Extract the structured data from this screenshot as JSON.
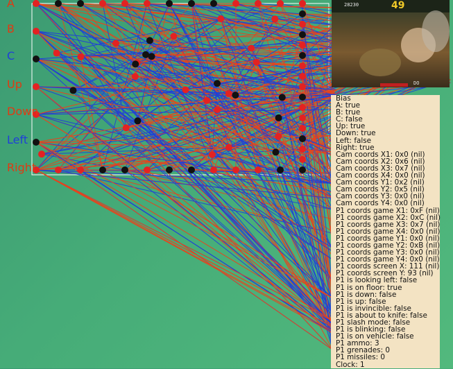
{
  "buttons": [
    {
      "label": "A",
      "color": "#e03a12"
    },
    {
      "label": "B",
      "color": "#e03a12"
    },
    {
      "label": "C",
      "color": "#1f3fd8"
    },
    {
      "label": "Up",
      "color": "#e03a12"
    },
    {
      "label": "Down",
      "color": "#e03a12"
    },
    {
      "label": "Left",
      "color": "#1f3fd8"
    },
    {
      "label": "Right",
      "color": "#e03a12"
    }
  ],
  "game_hud": {
    "score": "28230",
    "time": "49",
    "bottom_text": "DO"
  },
  "status_lines": [
    "Bias",
    "A: true",
    "B: true",
    "C: false",
    "Up: true",
    "Down: true",
    "Left: false",
    "Right: true",
    "Cam coords X1: 0x0 (nil)",
    "Cam coords X2: 0x6 (nil)",
    "Cam coords X3: 0x7 (nil)",
    "Cam coords X4: 0x0 (nil)",
    "Cam coords Y1: 0x2 (nil)",
    "Cam coords Y2: 0x5 (nil)",
    "Cam coords Y3: 0x0 (nil)",
    "Cam coords Y4: 0x0 (nil)",
    "P1 coords game X1: 0xF (nil)",
    "P1 coords game X2: 0xC (nil)",
    "P1 coords game X3: 0x7 (nil)",
    "P1 coords game X4: 0x0 (nil)",
    "P1 coords game Y1: 0x0 (nil)",
    "P1 coords game Y2: 0xB (nil)",
    "P1 coords game Y3: 0x0 (nil)",
    "P1 coords game Y4: 0x0 (nil)",
    "P1 coords screen X: 111 (nil)",
    "P1 coords screen Y: 93 (nil)",
    "P1 is looking left: false",
    "P1 is on floor: true",
    "P1 is down: false",
    "P1 is up: false",
    "P1 is invincible: false",
    "P1 is about to knife: false",
    "P1 slash mode: false",
    "P1 is blinking: false",
    "P1 is on vehicle: false",
    "P1 ammo: 3",
    "P1 grenades: 0",
    "P1 missiles: 0",
    "Clock: 1"
  ],
  "colors": {
    "positive": "#e8431c",
    "negative": "#1f3fd8",
    "node_active": "#e32222",
    "node_inactive": "#111111",
    "panel_bg": "#f3e3c3"
  }
}
